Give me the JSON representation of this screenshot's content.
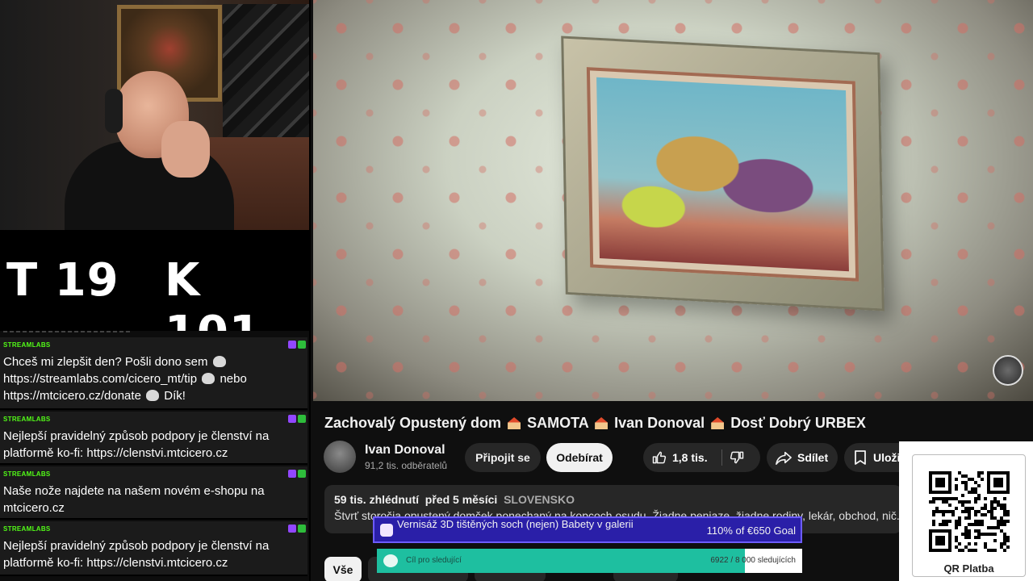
{
  "counter": {
    "t_label": "T 19",
    "k_label": "K 101"
  },
  "chat": {
    "messages": [
      {
        "author": "STREAMLABS",
        "text_1": "Chceš mi zlepšit den? Pošli dono sem",
        "text_2": "https://streamlabs.com/cicero_mt/tip",
        "text_3": "nebo",
        "text_4": "https://mtcicero.cz/donate",
        "text_5": "Dík!"
      },
      {
        "author": "STREAMLABS",
        "text": "Nejlepší pravidelný způsob podpory je členství na platformě ko-fi: https://clenstvi.mtcicero.cz"
      },
      {
        "author": "STREAMLABS",
        "text": "Naše nože najdete na našem novém e-shopu na mtcicero.cz"
      },
      {
        "author": "STREAMLABS",
        "text": "Nejlepší pravidelný způsob podpory je členství na platformě ko-fi: https://clenstvi.mtcicero.cz"
      }
    ]
  },
  "video": {
    "title_1": "Zachovalý Opustený dom",
    "title_2": "SAMOTA",
    "title_3": "Ivan Donoval",
    "title_4": "Dosť Dobrý URBEX",
    "channel_name": "Ivan Donoval",
    "channel_subs": "91,2 tis. odběratelů",
    "join_label": "Připojit se",
    "subscribe_label": "Odebírat",
    "like_count": "1,8 tis.",
    "share_label": "Sdílet",
    "save_label": "Uložit",
    "views": "59 tis. zhlédnutí",
    "age": "před 5 měsíci",
    "country_tag": "SLOVENSKO",
    "description": "Štvrť storočia opustený domček ponechaný na kopcoch osudu. Žiadne peniaze, žiadne rodiny, lekár, obchod, nič. Len",
    "chip_all": "Vše"
  },
  "overlay": {
    "goal_text": "Vernisáž 3D tištěných soch (nejen) Babety v galerii",
    "goal_progress": "110% of €650 Goal",
    "followers_label": "Cíl pro sledující",
    "followers_count": "6922 / 8 000 sledujících",
    "followers_fraction": 0.865,
    "qr_label": "QR Platba"
  }
}
